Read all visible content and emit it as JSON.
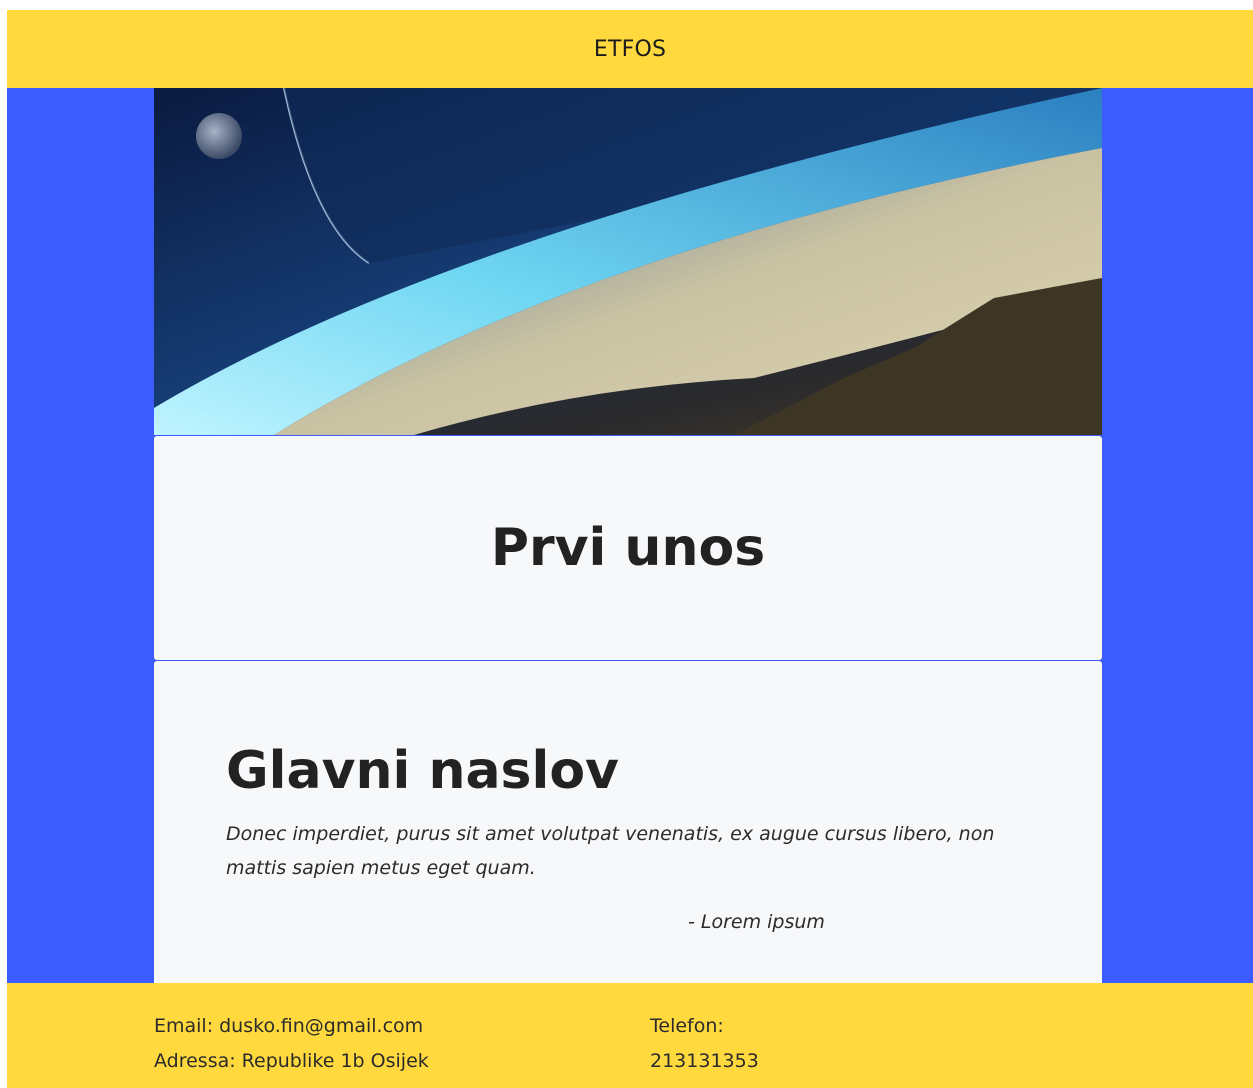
{
  "navbar": {
    "brand": "ETFOS"
  },
  "hero": {
    "image": "space-landscape-image"
  },
  "title_card": {
    "title": "Prvi unos"
  },
  "main_card": {
    "heading": "Glavni naslov",
    "quote": "Donec imperdiet, purus sit amet volutpat venenatis, ex augue cursus libero, non mattis sapien metus eget quam.",
    "author": "- Lorem ipsum"
  },
  "footer": {
    "email_label": "Email:",
    "email_value": "dusko.fin@gmail.com",
    "address_label": "Adressa:",
    "address_value": "Republike 1b Osijek",
    "phone_label": "Telefon:",
    "phone_value": "213131353"
  },
  "colors": {
    "background": "#3d5cff",
    "navbar": "#ffd93d",
    "card": "#f7f8fa",
    "text": "#222222"
  }
}
